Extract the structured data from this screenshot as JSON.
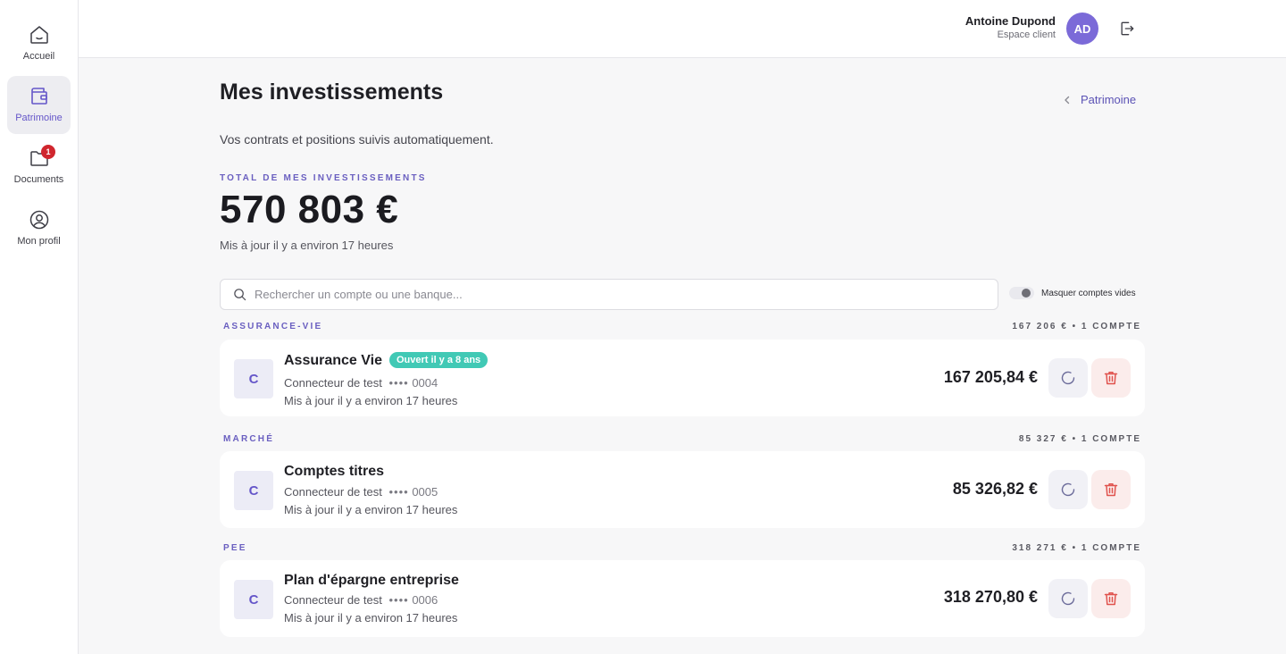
{
  "sidebar": {
    "items": [
      {
        "label": "Accueil",
        "icon": "home-icon"
      },
      {
        "label": "Patrimoine",
        "icon": "wallet-icon",
        "active": true
      },
      {
        "label": "Documents",
        "icon": "folder-icon",
        "badge": "1"
      },
      {
        "label": "Mon profil",
        "icon": "user-circle-icon"
      }
    ]
  },
  "header": {
    "user_name": "Antoine Dupond",
    "user_role": "Espace client",
    "avatar_initials": "AD",
    "logout_icon": "logout-icon"
  },
  "page": {
    "title": "Mes investissements",
    "back_label": "Patrimoine",
    "subtitle": "Vos contrats et positions suivis automatiquement.",
    "total_label": "TOTAL DE MES INVESTISSEMENTS",
    "total_value": "570 803 €",
    "total_updated": "Mis à jour il y a environ 17 heures"
  },
  "search": {
    "placeholder": "Rechercher un compte ou une banque...",
    "value": ""
  },
  "toggle": {
    "label": "Masquer comptes vides",
    "on": false
  },
  "groups": [
    {
      "label": "ASSURANCE-VIE",
      "summary": "167 206 € • 1 COMPTE",
      "account": {
        "logo": "C",
        "name": "Assurance Vie",
        "tag": "Ouvert il y a 8 ans",
        "connector": "Connecteur de test",
        "masked": "••••",
        "number": "0004",
        "updated": "Mis à jour il y a environ 17 heures",
        "amount": "167 205,84 €"
      }
    },
    {
      "label": "MARCHÉ",
      "summary": "85 327 € • 1 COMPTE",
      "account": {
        "logo": "C",
        "name": "Comptes titres",
        "connector": "Connecteur de test",
        "masked": "••••",
        "number": "0005",
        "updated": "Mis à jour il y a environ 17 heures",
        "amount": "85 326,82 €"
      }
    },
    {
      "label": "PEE",
      "summary": "318 271 € • 1 COMPTE",
      "account": {
        "logo": "C",
        "name": "Plan d'épargne entreprise",
        "connector": "Connecteur de test",
        "masked": "••••",
        "number": "0006",
        "updated": "Mis à jour il y a environ 17 heures",
        "amount": "318 270,80 €"
      }
    }
  ],
  "colors": {
    "accent": "#6556c9",
    "tag": "#41c9b5",
    "badge": "#d0262e",
    "delete": "#e0524d"
  }
}
